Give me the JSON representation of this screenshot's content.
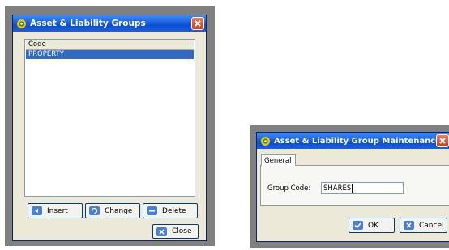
{
  "groups_window": {
    "title": "Asset & Liability Groups",
    "list": {
      "column_header": "Code",
      "rows": [
        "PROPERTY"
      ]
    },
    "buttons": {
      "insert": {
        "first": "I",
        "rest": "nsert"
      },
      "change": {
        "first": "C",
        "rest": "hange"
      },
      "delete": {
        "first": "D",
        "rest": "elete"
      },
      "close": "Close"
    }
  },
  "maintenance_window": {
    "title": "Asset & Liability Group Maintenance",
    "tab": "General",
    "group_code_label": "Group Code:",
    "group_code_value": "SHARES",
    "buttons": {
      "ok": "OK",
      "cancel": "Cancel"
    }
  },
  "icons": {
    "app": "app-gear-icon",
    "close": "close-x-icon",
    "insert": "insert-arrow-icon",
    "change": "change-refresh-icon",
    "delete": "delete-icon",
    "ok": "ok-check-icon",
    "cancel": "cancel-x-icon"
  },
  "colors": {
    "titlebar": "#0a4fd0",
    "selection": "#316ac5",
    "close_button": "#c8401e",
    "window_bg": "#ece9d8",
    "icon_blue": "#4a7fd4"
  }
}
